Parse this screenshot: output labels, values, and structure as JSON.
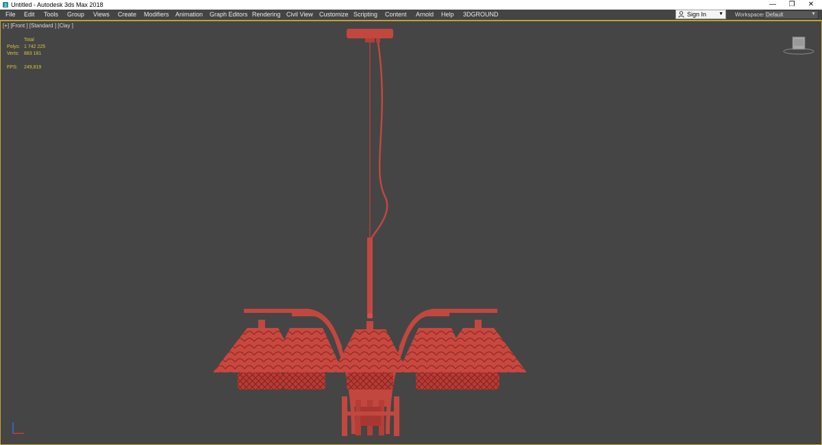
{
  "window": {
    "title": "Untitled - Autodesk 3ds Max 2018",
    "controls": {
      "minimize": "—",
      "restore": "❐",
      "close": "✕"
    }
  },
  "menu": {
    "items": [
      {
        "label": "File"
      },
      {
        "label": "Edit"
      },
      {
        "label": "Tools"
      },
      {
        "label": "Group"
      },
      {
        "label": "Views"
      },
      {
        "label": "Create"
      },
      {
        "label": "Modifiers"
      },
      {
        "label": "Animation"
      },
      {
        "label": "Graph Editors"
      },
      {
        "label": "Rendering"
      },
      {
        "label": "Civil View"
      },
      {
        "label": "Customize"
      },
      {
        "label": "Scripting"
      },
      {
        "label": "Content"
      },
      {
        "label": "Arnold"
      },
      {
        "label": "Help"
      },
      {
        "label": "3DGROUND"
      }
    ]
  },
  "account": {
    "sign_in_label": "Sign In"
  },
  "workspaces": {
    "label": "Workspaces:",
    "value": "Default"
  },
  "viewport": {
    "label": "[+] [Front ] [Standard ] [Clay ]",
    "stats": {
      "total_label": "Total",
      "polys_label": "Polys:",
      "polys_value": "1 742 225",
      "verts_label": "Verts:",
      "verts_value": "883 181",
      "fps_label": "FPS:",
      "fps_value": "249,819"
    }
  },
  "colors": {
    "model": "#c2473f",
    "viewport_bg": "#454545",
    "stats_text": "#d6c73a",
    "active_border": "#c9a82d"
  }
}
